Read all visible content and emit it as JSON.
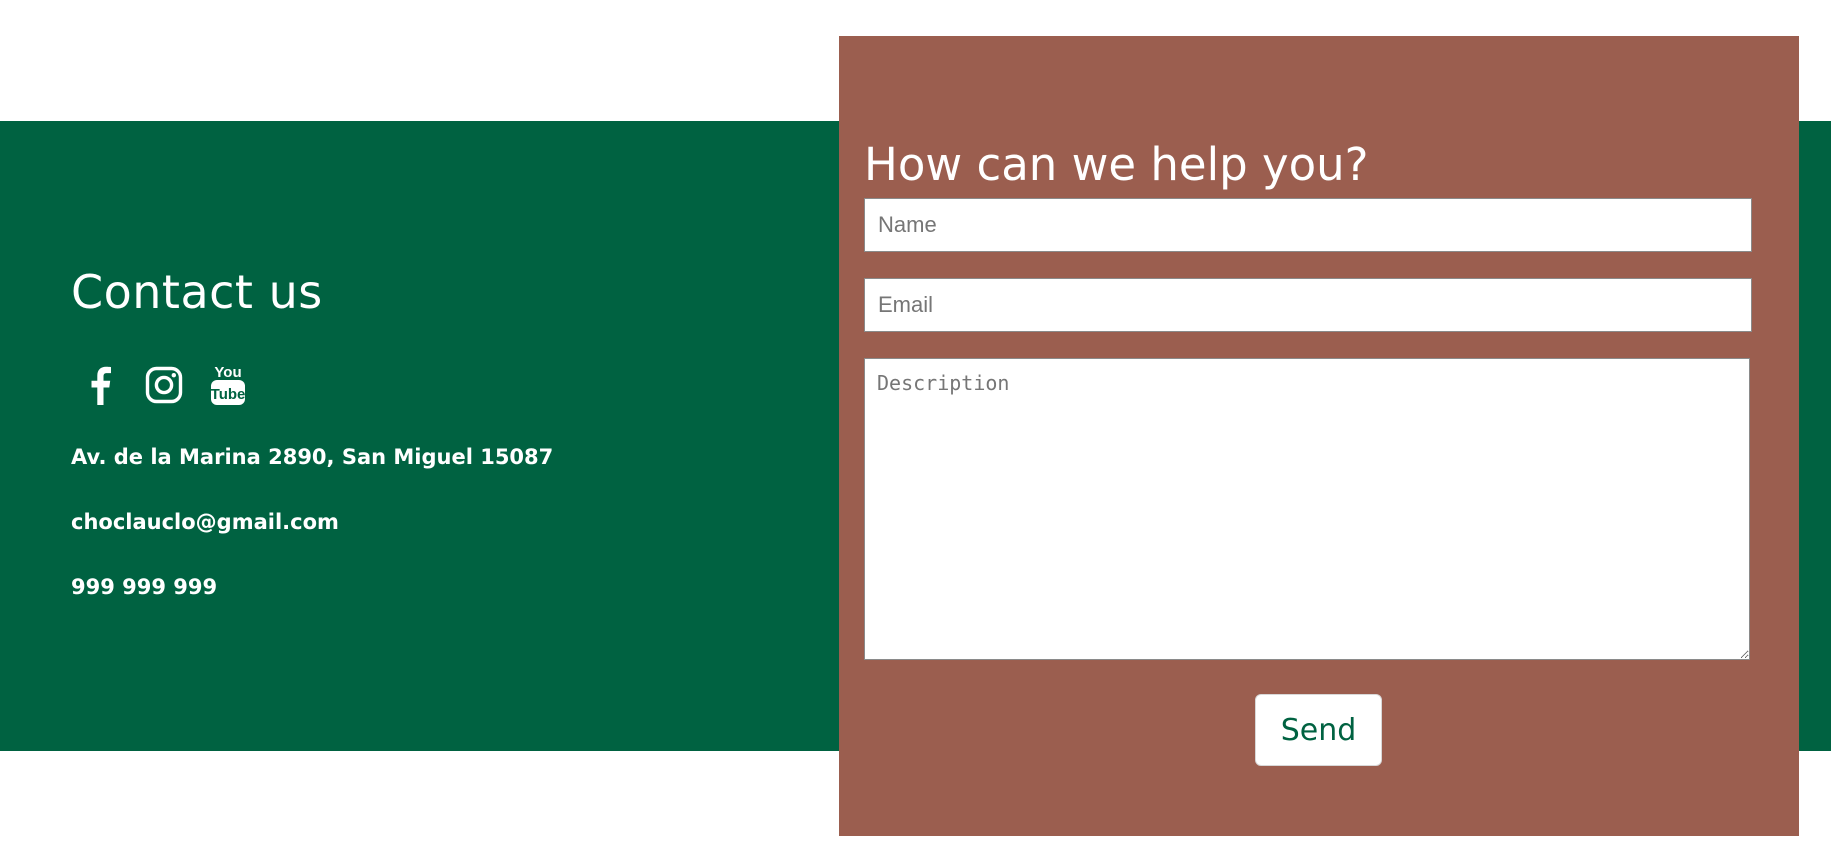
{
  "contact": {
    "title": "Contact us",
    "socials": [
      {
        "name": "facebook",
        "icon": "facebook-icon"
      },
      {
        "name": "instagram",
        "icon": "instagram-icon"
      },
      {
        "name": "youtube",
        "icon": "youtube-icon",
        "text_top": "You",
        "text_bottom": "Tube"
      }
    ],
    "address": "Av. de la Marina 2890, San Miguel 15087",
    "email": "choclauclo@gmail.com",
    "phone": "999 999 999"
  },
  "form": {
    "title": "How can we help you?",
    "name_placeholder": "Name",
    "email_placeholder": "Email",
    "description_placeholder": "Description",
    "send_label": "Send"
  },
  "colors": {
    "green": "#006241",
    "card": "#9b5e4f",
    "white": "#ffffff"
  }
}
